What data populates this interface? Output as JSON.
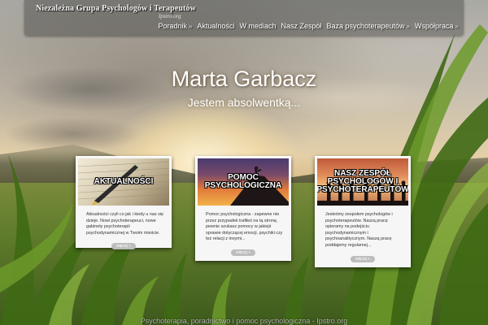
{
  "header": {
    "logo": "Niezależna Grupa Psychologów i Terapeutów",
    "domain": "Ipstro.org"
  },
  "nav": [
    {
      "label": "Poradnik",
      "dropdown": true
    },
    {
      "label": "Aktualności",
      "dropdown": false
    },
    {
      "label": "W mediach",
      "dropdown": false
    },
    {
      "label": "Nasz Zespół",
      "dropdown": false
    },
    {
      "label": "Baza psychoterapeutów",
      "dropdown": true
    },
    {
      "label": "Współpraca",
      "dropdown": true
    }
  ],
  "nav_arrow": "»",
  "hero": {
    "title": "Marta Garbacz",
    "subtitle": "Jestem absolwentką..."
  },
  "cards": [
    {
      "title": "AKTUALNOŚCI",
      "text": "Aktualności czyli co jak i kiedy u nas się dzieje. Nowi psychoterapeuci, nowe gabinety psychoterapii psychodynamicznej w Twoim mieście.",
      "more": "więcej »"
    },
    {
      "title": "POMOC PSYCHOLOGICZNA",
      "text": "Pomoc psychologiczna - zapewne nie przez przypadek trafiłeś na tą stronę, pewnie szukasz pomocy w jakiejś sprawie dotyczącej emocji, psychiki czy też relacji z innymi...",
      "more": "więcej »"
    },
    {
      "title": "NASZ ZESPÓŁ PSYCHOLOGÓW I PSYCHOTERAPEUTÓW",
      "text": "Jesteśmy zespołem psychologów i psychoterapeutów. Naszą pracę opieramy na podejściu psychodynamicznym i psychoanalitycznym. Naszą pracę poddajemy regularnej...",
      "more": "więcej »"
    }
  ],
  "footer": "Psychoterapia, poradnictwo i pomoc psychologiczna - Ipstro.org"
}
